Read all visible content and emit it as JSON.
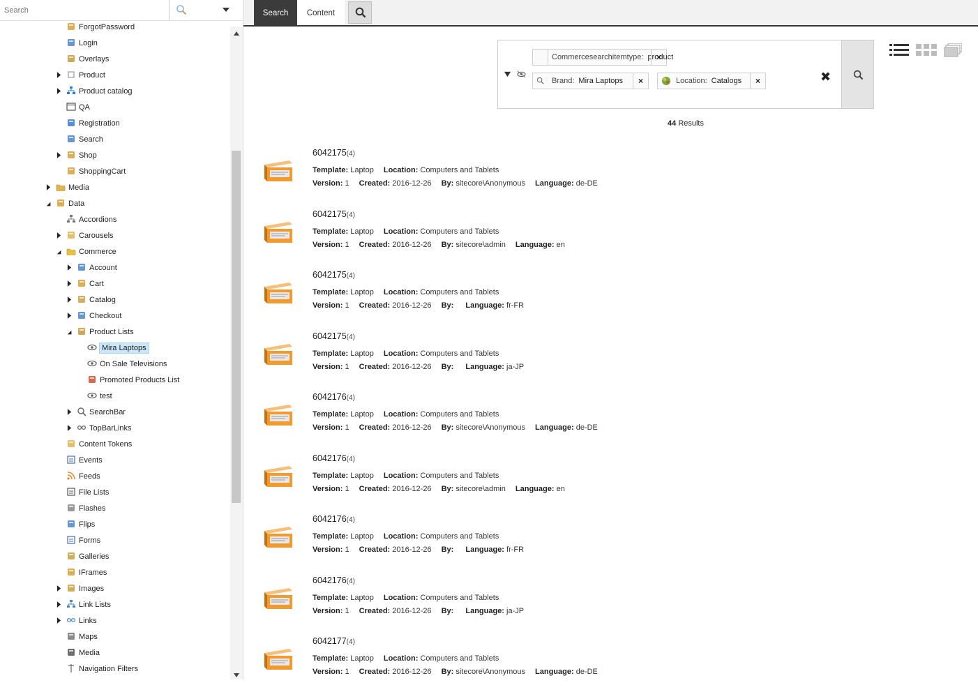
{
  "tree_search": {
    "placeholder": "Search"
  },
  "tree": [
    {
      "label": "ForgotPassword",
      "indent": 1,
      "toggle": "",
      "icon": "doc-icon",
      "color": "#d9a036"
    },
    {
      "label": "Login",
      "indent": 1,
      "toggle": "",
      "icon": "login-icon",
      "color": "#4a86c8"
    },
    {
      "label": "Overlays",
      "indent": 1,
      "toggle": "",
      "icon": "overlay-icon",
      "color": "#c79a3a"
    },
    {
      "label": "Product",
      "indent": 1,
      "toggle": "right",
      "icon": "page-icon",
      "color": "#999999"
    },
    {
      "label": "Product catalog",
      "indent": 1,
      "toggle": "right",
      "icon": "hierarchy-icon",
      "color": "#2c7bd0"
    },
    {
      "label": "QA",
      "indent": 1,
      "toggle": "",
      "icon": "window-icon",
      "color": "#555555"
    },
    {
      "label": "Registration",
      "indent": 1,
      "toggle": "",
      "icon": "users-icon",
      "color": "#3a7bd5"
    },
    {
      "label": "Search",
      "indent": 1,
      "toggle": "",
      "icon": "search-doc-icon",
      "color": "#4a86c8"
    },
    {
      "label": "Shop",
      "indent": 1,
      "toggle": "right",
      "icon": "shop-icon",
      "color": "#d9a036"
    },
    {
      "label": "ShoppingCart",
      "indent": 1,
      "toggle": "",
      "icon": "cart-doc-icon",
      "color": "#d9a036"
    },
    {
      "label": "Media",
      "indent": 0,
      "toggle": "right",
      "icon": "folder-icon",
      "color": "#e0b44e"
    },
    {
      "label": "Data",
      "indent": 0,
      "toggle": "down",
      "icon": "data-icon",
      "color": "#d9a036"
    },
    {
      "label": "Accordions",
      "indent": 1,
      "toggle": "",
      "icon": "accordion-icon",
      "color": "#777777"
    },
    {
      "label": "Carousels",
      "indent": 1,
      "toggle": "right",
      "icon": "carousel-icon",
      "color": "#e0b44e"
    },
    {
      "label": "Commerce",
      "indent": 1,
      "toggle": "down",
      "icon": "folder-icon",
      "color": "#e8c23e"
    },
    {
      "label": "Account",
      "indent": 2,
      "toggle": "right",
      "icon": "account-icon",
      "color": "#4a86c8"
    },
    {
      "label": "Cart",
      "indent": 2,
      "toggle": "right",
      "icon": "cart-icon",
      "color": "#d9a036"
    },
    {
      "label": "Catalog",
      "indent": 2,
      "toggle": "right",
      "icon": "catalog-icon",
      "color": "#c8a040"
    },
    {
      "label": "Checkout",
      "indent": 2,
      "toggle": "right",
      "icon": "checkout-icon",
      "color": "#4a86c8"
    },
    {
      "label": "Product Lists",
      "indent": 2,
      "toggle": "down",
      "icon": "product-lists-icon",
      "color": "#c79a3a"
    },
    {
      "label": "Mira Laptops",
      "indent": 3,
      "toggle": "",
      "icon": "eye-icon",
      "color": "#666666",
      "selected": true
    },
    {
      "label": "On Sale Televisions",
      "indent": 3,
      "toggle": "",
      "icon": "eye-icon",
      "color": "#666666"
    },
    {
      "label": "Promoted Products List",
      "indent": 3,
      "toggle": "",
      "icon": "promo-icon",
      "color": "#d0502a"
    },
    {
      "label": "test",
      "indent": 3,
      "toggle": "",
      "icon": "eye-icon",
      "color": "#666666"
    },
    {
      "label": "SearchBar",
      "indent": 2,
      "toggle": "right",
      "icon": "search-icon",
      "color": "#666666"
    },
    {
      "label": "TopBarLinks",
      "indent": 2,
      "toggle": "right",
      "icon": "link-icon",
      "color": "#666666"
    },
    {
      "label": "Content Tokens",
      "indent": 1,
      "toggle": "",
      "icon": "tokens-icon",
      "color": "#e0b44e"
    },
    {
      "label": "Events",
      "indent": 1,
      "toggle": "",
      "icon": "calendar-icon",
      "color": "#4a6fa8"
    },
    {
      "label": "Feeds",
      "indent": 1,
      "toggle": "",
      "icon": "rss-icon",
      "color": "#e88a2a"
    },
    {
      "label": "File Lists",
      "indent": 1,
      "toggle": "",
      "icon": "file-list-icon",
      "color": "#555555"
    },
    {
      "label": "Flashes",
      "indent": 1,
      "toggle": "",
      "icon": "flash-icon",
      "color": "#888888"
    },
    {
      "label": "Flips",
      "indent": 1,
      "toggle": "",
      "icon": "flip-icon",
      "color": "#4a86c8"
    },
    {
      "label": "Forms",
      "indent": 1,
      "toggle": "",
      "icon": "form-icon",
      "color": "#4a6fa8"
    },
    {
      "label": "Galleries",
      "indent": 1,
      "toggle": "",
      "icon": "gallery-icon",
      "color": "#c8a040"
    },
    {
      "label": "IFrames",
      "indent": 1,
      "toggle": "",
      "icon": "iframe-icon",
      "color": "#d9a036"
    },
    {
      "label": "Images",
      "indent": 1,
      "toggle": "right",
      "icon": "images-icon",
      "color": "#c8a040"
    },
    {
      "label": "Link Lists",
      "indent": 1,
      "toggle": "right",
      "icon": "link-list-icon",
      "color": "#4a86c8"
    },
    {
      "label": "Links",
      "indent": 1,
      "toggle": "right",
      "icon": "links-icon",
      "color": "#4a86c8"
    },
    {
      "label": "Maps",
      "indent": 1,
      "toggle": "",
      "icon": "map-icon",
      "color": "#777777"
    },
    {
      "label": "Media",
      "indent": 1,
      "toggle": "",
      "icon": "media-icon",
      "color": "#555555"
    },
    {
      "label": "Navigation Filters",
      "indent": 1,
      "toggle": "",
      "icon": "nav-filter-icon",
      "color": "#777777"
    }
  ],
  "tabs": {
    "search": "Search",
    "content": "Content"
  },
  "facets": {
    "chip1": {
      "key": "Commercesearchitemtype:",
      "value": "product"
    },
    "chip2": {
      "key": "Brand:",
      "value": "Mira Laptops"
    },
    "chip3": {
      "key": "Location:",
      "value": "Catalogs"
    }
  },
  "result_count": {
    "number": "44",
    "label": "Results"
  },
  "labels": {
    "template": "Template:",
    "location": "Location:",
    "version": "Version:",
    "created": "Created:",
    "by": "By:",
    "language": "Language:"
  },
  "results": [
    {
      "title": "6042175",
      "count": "(4)",
      "template": "Laptop",
      "location": "Computers and Tablets",
      "version": "1",
      "created": "2016-12-26",
      "by": "sitecore\\Anonymous",
      "language": "de-DE"
    },
    {
      "title": "6042175",
      "count": "(4)",
      "template": "Laptop",
      "location": "Computers and Tablets",
      "version": "1",
      "created": "2016-12-26",
      "by": "sitecore\\admin",
      "language": "en"
    },
    {
      "title": "6042175",
      "count": "(4)",
      "template": "Laptop",
      "location": "Computers and Tablets",
      "version": "1",
      "created": "2016-12-26",
      "by": "",
      "language": "fr-FR"
    },
    {
      "title": "6042175",
      "count": "(4)",
      "template": "Laptop",
      "location": "Computers and Tablets",
      "version": "1",
      "created": "2016-12-26",
      "by": "",
      "language": "ja-JP"
    },
    {
      "title": "6042176",
      "count": "(4)",
      "template": "Laptop",
      "location": "Computers and Tablets",
      "version": "1",
      "created": "2016-12-26",
      "by": "sitecore\\Anonymous",
      "language": "de-DE"
    },
    {
      "title": "6042176",
      "count": "(4)",
      "template": "Laptop",
      "location": "Computers and Tablets",
      "version": "1",
      "created": "2016-12-26",
      "by": "sitecore\\admin",
      "language": "en"
    },
    {
      "title": "6042176",
      "count": "(4)",
      "template": "Laptop",
      "location": "Computers and Tablets",
      "version": "1",
      "created": "2016-12-26",
      "by": "",
      "language": "fr-FR"
    },
    {
      "title": "6042176",
      "count": "(4)",
      "template": "Laptop",
      "location": "Computers and Tablets",
      "version": "1",
      "created": "2016-12-26",
      "by": "",
      "language": "ja-JP"
    },
    {
      "title": "6042177",
      "count": "(4)",
      "template": "Laptop",
      "location": "Computers and Tablets",
      "version": "1",
      "created": "2016-12-26",
      "by": "sitecore\\Anonymous",
      "language": "de-DE"
    }
  ],
  "colors": {
    "accent_tab": "#3b3b3b",
    "selected_bg": "#cbe6f7",
    "thumb_orange": "#f29a2e"
  }
}
